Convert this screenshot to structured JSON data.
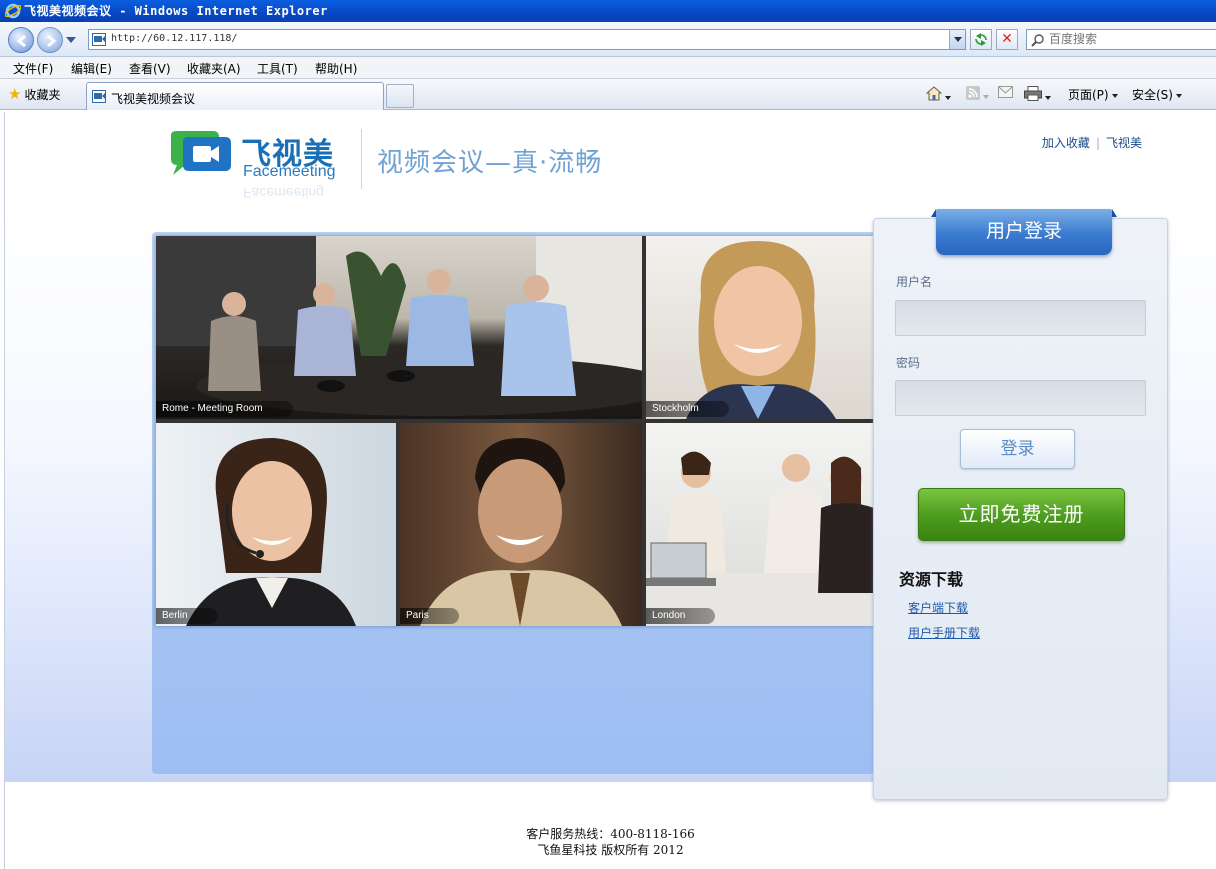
{
  "window": {
    "title": "飞视美视频会议 - Windows Internet Explorer"
  },
  "address": {
    "url": "http://60.12.117.118/",
    "search_placeholder": "百度搜索"
  },
  "menu": [
    "文件(F)",
    "编辑(E)",
    "查看(V)",
    "收藏夹(A)",
    "工具(T)",
    "帮助(H)"
  ],
  "favorites": {
    "label": "收藏夹"
  },
  "tab": {
    "label": "飞视美视频会议"
  },
  "commands": {
    "page": "页面(P)",
    "safety": "安全(S)"
  },
  "site": {
    "logo_cn": "飞视美",
    "logo_en": "Facemeeting",
    "slogan": "视频会议—真·流畅",
    "links": [
      "加入收藏",
      "飞视美"
    ]
  },
  "photos": [
    {
      "caption": "Rome - Meeting Room"
    },
    {
      "caption": "Stockholm"
    },
    {
      "caption": "Berlin"
    },
    {
      "caption": "Paris"
    },
    {
      "caption": "London"
    }
  ],
  "login": {
    "title": "用户登录",
    "username_label": "用户名",
    "password_label": "密码",
    "login_button": "登录",
    "register_button": "立即免费注册"
  },
  "resources": {
    "title": "资源下载",
    "links": [
      "客户端下载",
      "用户手册下载"
    ]
  },
  "footer": {
    "hotline": "客户服务热线：400-8118-166",
    "copyright": "飞鱼星科技 版权所有 2012"
  },
  "colors": {
    "brand_blue": "#1b6fb4",
    "register_green": "#4c9b1f",
    "ie_titlebar": "#0848c4"
  }
}
